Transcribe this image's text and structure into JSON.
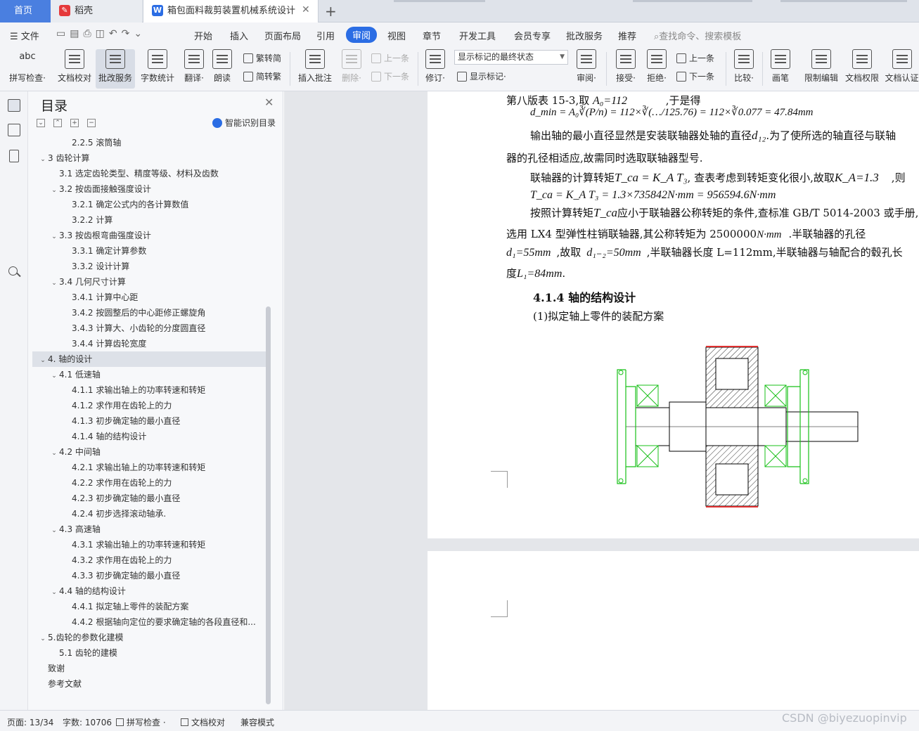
{
  "tabs": {
    "home": "首页",
    "daoke": "稻壳",
    "document": "箱包面料裁剪装置机械系统设计"
  },
  "menu": {
    "file": "文件",
    "items": [
      "开始",
      "插入",
      "页面布局",
      "引用",
      "审阅",
      "视图",
      "章节",
      "开发工具",
      "会员专享",
      "批改服务",
      "推荐"
    ],
    "search": "查找命令、搜索模板"
  },
  "ribbon": {
    "spell_check": "拼写检查·",
    "doc_proofread": "文档校对",
    "batch_service": "批改服务",
    "word_count": "字数统计",
    "translate": "翻译·",
    "read_aloud": "朗读",
    "trad_to_simp": "繁转简",
    "simp_to_trad": "简转繁",
    "insert_comment": "插入批注",
    "delete": "删除·",
    "prev_item": "上一条",
    "next_item": "下一条",
    "revise": "修订·",
    "markup_state": "显示标记的最终状态",
    "show_markup": "显示标记·",
    "review": "审阅·",
    "accept": "接受·",
    "reject": "拒绝·",
    "compare": "比较·",
    "pen": "画笔",
    "restrict_edit": "限制编辑",
    "doc_permission": "文档权限",
    "doc_certify": "文档认证"
  },
  "toc": {
    "title": "目录",
    "smart": "智能识别目录",
    "items": [
      {
        "label": "2.2.5 滚筒轴",
        "level": 3,
        "expand": ""
      },
      {
        "label": "3 齿轮计算",
        "level": 1,
        "expand": "open"
      },
      {
        "label": "3.1 选定齿轮类型、精度等级、材料及齿数",
        "level": 2,
        "expand": ""
      },
      {
        "label": "3.2 按齿面接触强度设计",
        "level": 2,
        "expand": "open"
      },
      {
        "label": "3.2.1 确定公式内的各计算数值",
        "level": 3,
        "expand": ""
      },
      {
        "label": "3.2.2 计算",
        "level": 3,
        "expand": ""
      },
      {
        "label": "3.3 按齿根弯曲强度设计",
        "level": 2,
        "expand": "open"
      },
      {
        "label": "3.3.1 确定计算参数",
        "level": 3,
        "expand": ""
      },
      {
        "label": "3.3.2 设计计算",
        "level": 3,
        "expand": ""
      },
      {
        "label": "3.4 几何尺寸计算",
        "level": 2,
        "expand": "open"
      },
      {
        "label": "3.4.1 计算中心距",
        "level": 3,
        "expand": ""
      },
      {
        "label": "3.4.2 按圆整后的中心距修正螺旋角",
        "level": 3,
        "expand": ""
      },
      {
        "label": "3.4.3 计算大、小齿轮的分度圆直径",
        "level": 3,
        "expand": ""
      },
      {
        "label": "3.4.4 计算齿轮宽度",
        "level": 3,
        "expand": ""
      },
      {
        "label": "4.   轴的设计",
        "level": 1,
        "expand": "open",
        "selected": true
      },
      {
        "label": "4.1 低速轴",
        "level": 2,
        "expand": "open"
      },
      {
        "label": "4.1.1 求输出轴上的功率转速和转矩",
        "level": 3,
        "expand": ""
      },
      {
        "label": "4.1.2 求作用在齿轮上的力",
        "level": 3,
        "expand": ""
      },
      {
        "label": "4.1.3 初步确定轴的最小直径",
        "level": 3,
        "expand": ""
      },
      {
        "label": "4.1.4 轴的结构设计",
        "level": 3,
        "expand": ""
      },
      {
        "label": "4.2 中间轴",
        "level": 2,
        "expand": "open"
      },
      {
        "label": "4.2.1 求输出轴上的功率转速和转矩",
        "level": 3,
        "expand": ""
      },
      {
        "label": "4.2.2 求作用在齿轮上的力",
        "level": 3,
        "expand": ""
      },
      {
        "label": "4.2.3 初步确定轴的最小直径",
        "level": 3,
        "expand": ""
      },
      {
        "label": "4.2.4 初步选择滚动轴承.",
        "level": 3,
        "expand": ""
      },
      {
        "label": "4.3 高速轴",
        "level": 2,
        "expand": "open"
      },
      {
        "label": "4.3.1 求输出轴上的功率转速和转矩",
        "level": 3,
        "expand": ""
      },
      {
        "label": "4.3.2 求作用在齿轮上的力",
        "level": 3,
        "expand": ""
      },
      {
        "label": "4.3.3 初步确定轴的最小直径",
        "level": 3,
        "expand": ""
      },
      {
        "label": "4.4 轴的结构设计",
        "level": 2,
        "expand": "open"
      },
      {
        "label": "4.4.1 拟定轴上零件的装配方案",
        "level": 3,
        "expand": ""
      },
      {
        "label": "4.4.2 根据轴向定位的要求确定轴的各段直径和...",
        "level": 3,
        "expand": ""
      },
      {
        "label": "5.齿轮的参数化建模",
        "level": 1,
        "expand": "open"
      },
      {
        "label": "5.1 齿轮的建模",
        "level": 2,
        "expand": ""
      },
      {
        "label": "致谢",
        "level": 1,
        "expand": ""
      },
      {
        "label": "参考文献",
        "level": 1,
        "expand": ""
      }
    ]
  },
  "doc": {
    "line1a": "第八版表 15-3,取",
    "a0_eq": "A₀=112",
    "line1b": ",于是得",
    "dmin_formula": "d_min = A₀∛(P/n) = 112×∛(…/125.76) = 112×∛0.077 = 47.84mm",
    "p2a": "输出轴的最小直径显然是安装联轴器处轴的直径",
    "d12": "d₁₂",
    "p2b": ".为了使所选的轴直径与联轴",
    "p3": "器的孔径相适应,故需同时选取联轴器型号.",
    "p4a": "联轴器的计算转矩",
    "tca_formula": "T_ca = K_A T₃",
    "p4b": ", 查表考虑到转矩变化很小,故取",
    "ka": "K_A=1.3",
    "p4c": ",则",
    "tca_value": "T_ca = K_A T₃ = 1.3×735842N·mm = 956594.6N·mm",
    "p5a": "按照计算转矩",
    "tca": "T_ca",
    "p5b": "应小于联轴器公称转矩的条件,查标准 GB/T 5014-2003 或手册,",
    "p6a": "选用 LX4 型弹性柱销联轴器,其公称转矩为 2500000",
    "nmm": "N·mm",
    "p6b": ".半联轴器的孔径",
    "d1": "d₁=55mm",
    "p7a": ",故取",
    "d12_value": "d₁₋₂=50mm",
    "p7b": ",半联轴器长度 L=112mm,半联轴器与轴配合的毂孔长",
    "p8a": "度",
    "l1": "L₁=84mm",
    "p8b": ".",
    "heading": "4.1.4 轴的结构设计",
    "p9": "(1)拟定轴上零件的装配方案"
  },
  "status": {
    "page": "页面: 13/34",
    "words": "字数: 10706",
    "spell": "拼写检查 ·",
    "proofread": "文档校对",
    "compat": "兼容模式"
  },
  "watermark": "CSDN @biyezuopinvip"
}
